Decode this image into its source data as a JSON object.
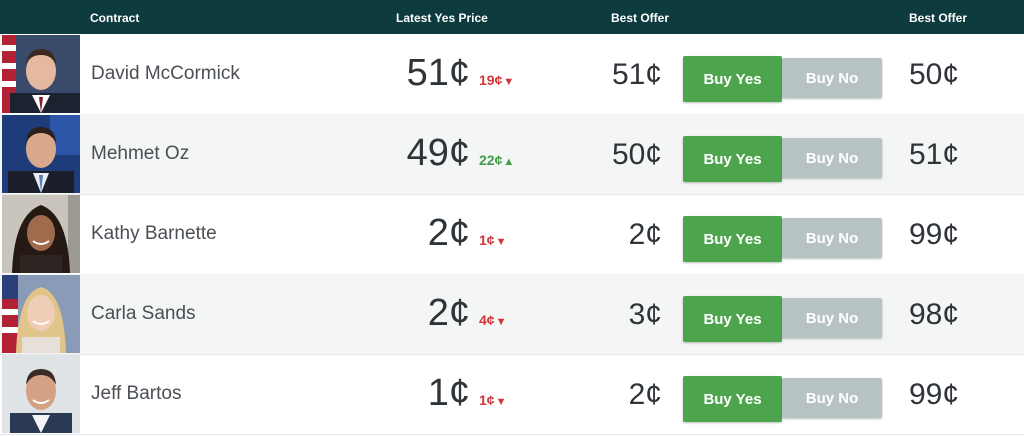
{
  "header": {
    "contract": "Contract",
    "latest_yes_price": "Latest Yes Price",
    "best_offer_yes": "Best Offer",
    "best_offer_no": "Best Offer"
  },
  "colors": {
    "header_bg": "#0e3b3d",
    "buy_yes": "#4ca54c",
    "buy_no": "#b7c3c3",
    "down": "#d0363a",
    "up": "#3e9b46"
  },
  "rows": [
    {
      "name": "David McCormick",
      "price": "51¢",
      "change": "19¢",
      "direction": "down",
      "arrow": "▼",
      "best_offer_yes": "51¢",
      "buy_yes": "Buy Yes",
      "buy_no": "Buy No",
      "best_offer_no": "50¢"
    },
    {
      "name": "Mehmet Oz",
      "price": "49¢",
      "change": "22¢",
      "direction": "up",
      "arrow": "▲",
      "best_offer_yes": "50¢",
      "buy_yes": "Buy Yes",
      "buy_no": "Buy No",
      "best_offer_no": "51¢"
    },
    {
      "name": "Kathy Barnette",
      "price": "2¢",
      "change": "1¢",
      "direction": "down",
      "arrow": "▼",
      "best_offer_yes": "2¢",
      "buy_yes": "Buy Yes",
      "buy_no": "Buy No",
      "best_offer_no": "99¢"
    },
    {
      "name": "Carla Sands",
      "price": "2¢",
      "change": "4¢",
      "direction": "down",
      "arrow": "▼",
      "best_offer_yes": "3¢",
      "buy_yes": "Buy Yes",
      "buy_no": "Buy No",
      "best_offer_no": "98¢"
    },
    {
      "name": "Jeff Bartos",
      "price": "1¢",
      "change": "1¢",
      "direction": "down",
      "arrow": "▼",
      "best_offer_yes": "2¢",
      "buy_yes": "Buy Yes",
      "buy_no": "Buy No",
      "best_offer_no": "99¢"
    }
  ]
}
